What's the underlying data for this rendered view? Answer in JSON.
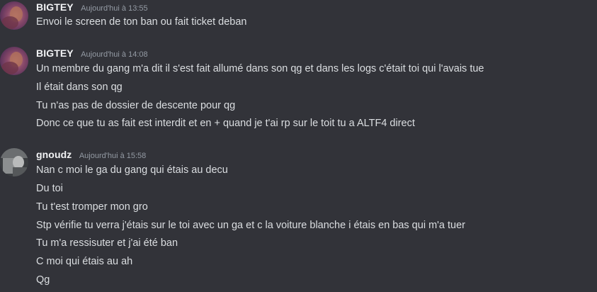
{
  "messages": [
    {
      "author": "BIGTEY",
      "timestamp": "Aujourd'hui à 13:55",
      "lines": [
        "Envoi le screen de ton ban ou fait ticket deban"
      ]
    },
    {
      "author": "BIGTEY",
      "timestamp": "Aujourd'hui à 14:08",
      "lines": [
        "Un membre du gang m'a dit il s'est fait allumé dans son qg et dans les logs c'était toi qui l'avais tue",
        "Il était dans son qg",
        "Tu n'as pas de dossier de descente pour qg",
        "Donc ce que tu as fait est interdit et en + quand je t'ai rp sur le toit tu a ALTF4 direct"
      ]
    },
    {
      "author": "gnoudz",
      "timestamp": "Aujourd'hui à 15:58",
      "lines": [
        "Nan c moi le ga du gang qui étais au decu",
        "Du toi",
        "Tu t'est tromper mon gro",
        "Stp vérifie tu verra j'étais sur le toi avec un ga et c la voiture blanche i étais en bas qui m'a tuer",
        "Tu m'a ressisuter et j'ai été ban",
        "C moi qui étais au ah",
        "Qg"
      ]
    }
  ],
  "colors": {
    "background": "#323339",
    "username": "#f2f3f5",
    "timestamp": "#949ba4",
    "text": "#dbdee1"
  }
}
